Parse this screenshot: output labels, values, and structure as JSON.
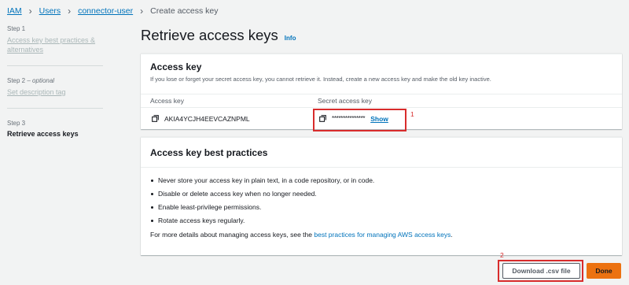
{
  "breadcrumb": {
    "items": [
      "IAM",
      "Users",
      "connector-user"
    ],
    "current": "Create access key"
  },
  "steps": [
    {
      "num": "Step 1",
      "title": "Access key best practices & alternatives"
    },
    {
      "num": "Step 2",
      "num_suffix": "optional",
      "title": "Set description tag"
    },
    {
      "num": "Step 3",
      "title": "Retrieve access keys"
    }
  ],
  "page": {
    "title": "Retrieve access keys",
    "info": "Info"
  },
  "access_key_card": {
    "title": "Access key",
    "description": "If you lose or forget your secret access key, you cannot retrieve it. Instead, create a new access key and make the old key inactive.",
    "columns": [
      "Access key",
      "Secret access key"
    ],
    "access_key_id": "AKIA4YCJH4EEVCAZNPML",
    "secret_masked": "***************",
    "show_label": "Show"
  },
  "best_practices_card": {
    "title": "Access key best practices",
    "items": [
      "Never store your access key in plain text, in a code repository, or in code.",
      "Disable or delete access key when no longer needed.",
      "Enable least-privilege permissions.",
      "Rotate access keys regularly."
    ],
    "more_prefix": "For more details about managing access keys, see the ",
    "more_link": "best practices for managing AWS access keys",
    "more_suffix": "."
  },
  "buttons": {
    "download": "Download .csv file",
    "done": "Done"
  },
  "annotations": {
    "first": "1",
    "second": "2"
  },
  "colors": {
    "link": "#0073bb",
    "primary_button": "#ec7211",
    "annotation": "#d82c2c",
    "background": "#f2f3f3"
  },
  "icons": [
    "chevron-right-icon",
    "copy-icon"
  ]
}
